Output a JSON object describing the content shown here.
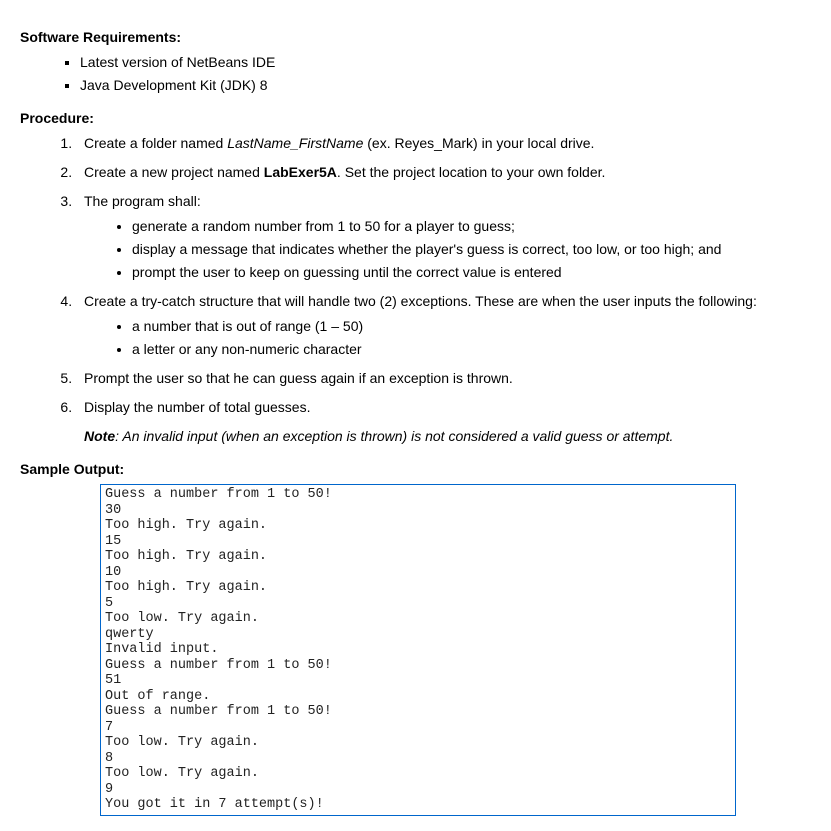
{
  "sections": {
    "software_req_heading": "Software Requirements:",
    "software_items": [
      "Latest version of NetBeans IDE",
      "Java Development Kit (JDK) 8"
    ],
    "procedure_heading": "Procedure:",
    "proc1_pre": "Create a folder named ",
    "proc1_italic": "LastName_FirstName",
    "proc1_post": " (ex. Reyes_Mark) in your local drive.",
    "proc2_pre": "Create a new project named ",
    "proc2_bold": "LabExer5A",
    "proc2_post": ". Set the project location to your own folder.",
    "proc3_intro": "The program shall:",
    "proc3_items": [
      "generate a random number from 1 to 50 for a player to guess;",
      "display a message that indicates whether the player's guess is correct, too low, or too high; and",
      "prompt the user to keep on guessing until the correct value is entered"
    ],
    "proc4_intro": "Create a try-catch structure that will handle two (2) exceptions. These are when the user inputs the following:",
    "proc4_items": [
      "a number that is out of range (1 – 50)",
      "a letter or any non-numeric character"
    ],
    "proc5": "Prompt the user so that he can guess again if an exception is thrown.",
    "proc6": "Display the number of total guesses.",
    "note_label": "Note",
    "note_text": ": An invalid input (when an exception is thrown) is not considered a valid guess or attempt.",
    "sample_output_heading": "Sample Output:",
    "output_lines": "Guess a number from 1 to 50!\n30\nToo high. Try again.\n15\nToo high. Try again.\n10\nToo high. Try again.\n5\nToo low. Try again.\nqwerty\nInvalid input.\nGuess a number from 1 to 50!\n51\nOut of range.\nGuess a number from 1 to 50!\n7\nToo low. Try again.\n8\nToo low. Try again.\n9\nYou got it in 7 attempt(s)!"
  }
}
